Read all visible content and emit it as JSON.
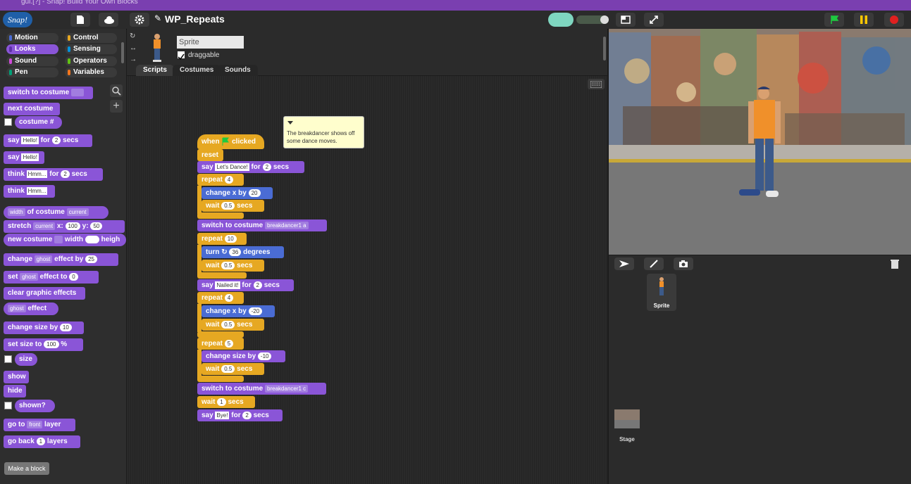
{
  "window": {
    "os_title": "gui.[?] - Snap! Build Your Own Blocks"
  },
  "top_bar": {
    "logo": "Snap!",
    "project_title": "WP_Repeats"
  },
  "categories": [
    {
      "label": "Motion",
      "color": "#4a6cd4"
    },
    {
      "label": "Control",
      "color": "#e6a822"
    },
    {
      "label": "Looks",
      "color": "#8a55d7",
      "selected": true
    },
    {
      "label": "Sensing",
      "color": "#0494dc"
    },
    {
      "label": "Sound",
      "color": "#cf4ad9"
    },
    {
      "label": "Operators",
      "color": "#62c213"
    },
    {
      "label": "Pen",
      "color": "#00a178"
    },
    {
      "label": "Variables",
      "color": "#f3761d"
    }
  ],
  "palette": {
    "switch_to_costume": "switch to costume",
    "next_costume": "next costume",
    "costume_num": "costume #",
    "say": "say",
    "say_text": "Hello!",
    "for": "for",
    "secs_val": "2",
    "secs": "secs",
    "say2": "say",
    "say2_text": "Hello!",
    "think": "think",
    "think_text": "Hmm...",
    "think_for": "for",
    "think_secs_val": "2",
    "think_secs": "secs",
    "think2": "think",
    "think2_text": "Hmm...",
    "width_dd": "width",
    "of_costume": "of costume",
    "current_dd": "current",
    "stretch": "stretch",
    "stretch_dd": "current",
    "x_label": "x:",
    "x_val": "100",
    "y_label": "y:",
    "y_val": "50",
    "new_costume": "new costume",
    "width_label": "width",
    "height_label": "heigh",
    "change": "change",
    "ghost_dd": "ghost",
    "effect_by": "effect by",
    "effect_val": "25",
    "set": "set",
    "set_ghost_dd": "ghost",
    "effect_to": "effect to",
    "set_val": "0",
    "clear_effects": "clear graphic effects",
    "ghost_effect_dd": "ghost",
    "effect_label": "effect",
    "change_size": "change size by",
    "change_size_val": "10",
    "set_size": "set size to",
    "set_size_val": "100",
    "pct": "%",
    "size": "size",
    "show": "show",
    "hide": "hide",
    "shown": "shown?",
    "go_to": "go to",
    "front_dd": "front",
    "layer": "layer",
    "go_back": "go back",
    "back_val": "1",
    "layers": "layers",
    "make_block": "Make a block"
  },
  "sprite": {
    "name": "Sprite",
    "draggable": "draggable"
  },
  "tabs": {
    "scripts": "Scripts",
    "costumes": "Costumes",
    "sounds": "Sounds"
  },
  "script": {
    "when": "when",
    "clicked": "clicked",
    "reset": "reset",
    "say1": "say",
    "say1_text": "Let's Dance!",
    "say1_for": "for",
    "say1_secs": "2",
    "say1_secs_label": "secs",
    "repeat1": "repeat",
    "repeat1_val": "4",
    "changex1": "change x by",
    "changex1_val": "20",
    "wait1": "wait",
    "wait1_val": "0.5",
    "wait1_secs": "secs",
    "switch1": "switch to costume",
    "switch1_dd": "breakdancer1 a",
    "repeat2": "repeat",
    "repeat2_val": "10",
    "turn": "turn",
    "turn_val": "36",
    "degrees": "degrees",
    "wait2": "wait",
    "wait2_val": "0.5",
    "wait2_secs": "secs",
    "say2": "say",
    "say2_text": "Nailed it!",
    "say2_for": "for",
    "say2_secs": "2",
    "say2_secs_label": "secs",
    "repeat3": "repeat",
    "repeat3_val": "4",
    "changex2": "change x by",
    "changex2_val": "-20",
    "wait3": "wait",
    "wait3_val": "0.5",
    "wait3_secs": "secs",
    "repeat4": "repeat",
    "repeat4_val": "5",
    "changesize": "change size by",
    "changesize_val": "-10",
    "wait4": "wait",
    "wait4_val": "0.5",
    "wait4_secs": "secs",
    "switch2": "switch to costume",
    "switch2_dd": "breakdancer1 c",
    "wait5": "wait",
    "wait5_val": "1",
    "wait5_secs": "secs",
    "say3": "say",
    "say3_text": "Bye!",
    "say3_for": "for",
    "say3_secs": "2",
    "say3_secs_label": "secs",
    "comment": "The breakdancer shows off some dance moves."
  },
  "corral": {
    "sprite_label": "Sprite",
    "stage_label": "Stage"
  }
}
